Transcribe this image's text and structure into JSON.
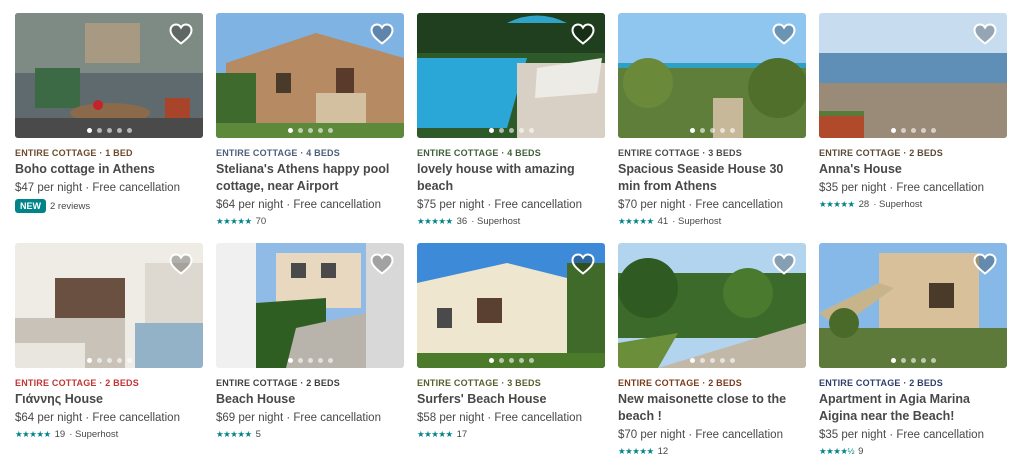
{
  "listings": [
    {
      "kicker": "Entire cottage · 1 bed",
      "kicker_color": "#6d4a2b",
      "title": "Boho cottage in Athens",
      "price": "$47",
      "per_night": "per night",
      "cancel": "· Free cancellation",
      "badge": "NEW",
      "reviews": "2 reviews",
      "stars": "",
      "rating_count": "",
      "superhost": "",
      "active_dot": 1,
      "photo_theme": "patio"
    },
    {
      "kicker": "Entire cottage · 4 beds",
      "kicker_color": "#4b5f7a",
      "title": "Steliana's Athens happy pool cottage, near Airport",
      "price": "$64",
      "per_night": "per night",
      "cancel": "· Free cancellation",
      "badge": "",
      "reviews": "",
      "stars": "★★★★★",
      "rating_count": "70",
      "superhost": "",
      "active_dot": 1,
      "photo_theme": "stone-house"
    },
    {
      "kicker": "Entire cottage · 4 beds",
      "kicker_color": "#3f5f3a",
      "title": "lovely house with amazing beach",
      "price": "$75",
      "per_night": "per night",
      "cancel": "· Free cancellation",
      "badge": "",
      "reviews": "",
      "stars": "★★★★★",
      "rating_count": "36",
      "superhost": "· Superhost",
      "active_dot": 1,
      "photo_theme": "pool"
    },
    {
      "kicker": "Entire cottage · 3 beds",
      "kicker_color": "#4a4a4a",
      "title": "Spacious Seaside House 30 min from Athens",
      "price": "$70",
      "per_night": "per night",
      "cancel": "· Free cancellation",
      "badge": "",
      "reviews": "",
      "stars": "★★★★★",
      "rating_count": "41",
      "superhost": "· Superhost",
      "active_dot": 1,
      "photo_theme": "seaside"
    },
    {
      "kicker": "Entire cottage · 2 beds",
      "kicker_color": "#5a4a35",
      "title": "Anna's House",
      "price": "$35",
      "per_night": "per night",
      "cancel": "· Free cancellation",
      "badge": "",
      "reviews": "",
      "stars": "★★★★★",
      "rating_count": "28",
      "superhost": "· Superhost",
      "active_dot": 1,
      "photo_theme": "beach"
    },
    {
      "kicker": "Entire cottage · 2 beds",
      "kicker_color": "#c13535",
      "title": "Γιάννης House",
      "price": "$64",
      "per_night": "per night",
      "cancel": "· Free cancellation",
      "badge": "",
      "reviews": "",
      "stars": "★★★★★",
      "rating_count": "19",
      "superhost": "· Superhost",
      "active_dot": 1,
      "photo_theme": "interior"
    },
    {
      "kicker": "Entire cottage · 2 beds",
      "kicker_color": "#3f3f3f",
      "title": "Beach House",
      "price": "$69",
      "per_night": "per night",
      "cancel": "· Free cancellation",
      "badge": "",
      "reviews": "",
      "stars": "★★★★★",
      "rating_count": "5",
      "superhost": "",
      "active_dot": 1,
      "photo_theme": "villa"
    },
    {
      "kicker": "Entire cottage · 3 beds",
      "kicker_color": "#55602e",
      "title": "Surfers' Beach House",
      "price": "$58",
      "per_night": "per night",
      "cancel": "· Free cancellation",
      "badge": "",
      "reviews": "",
      "stars": "★★★★★",
      "rating_count": "17",
      "superhost": "",
      "active_dot": 1,
      "photo_theme": "white-house"
    },
    {
      "kicker": "Entire cottage · 2 beds",
      "kicker_color": "#7a3b1e",
      "title": "New maisonette close to the beach !",
      "price": "$70",
      "per_night": "per night",
      "cancel": "· Free cancellation",
      "badge": "",
      "reviews": "",
      "stars": "★★★★★",
      "rating_count": "12",
      "superhost": "",
      "active_dot": 1,
      "photo_theme": "road"
    },
    {
      "kicker": "Entire cottage · 2 beds",
      "kicker_color": "#2f3f6a",
      "title": "Apartment in Agia Marina Aigina near the Beach!",
      "price": "$35",
      "per_night": "per night",
      "cancel": "· Free cancellation",
      "badge": "",
      "reviews": "",
      "stars": "★★★★½",
      "rating_count": "9",
      "superhost": "",
      "active_dot": 1,
      "photo_theme": "stairs"
    }
  ]
}
